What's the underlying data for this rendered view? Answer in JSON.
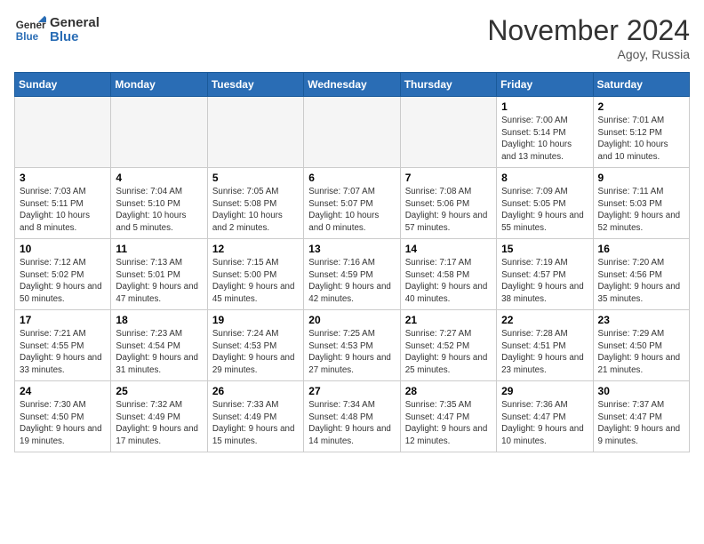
{
  "header": {
    "logo_general": "General",
    "logo_blue": "Blue",
    "month": "November 2024",
    "location": "Agoy, Russia"
  },
  "weekdays": [
    "Sunday",
    "Monday",
    "Tuesday",
    "Wednesday",
    "Thursday",
    "Friday",
    "Saturday"
  ],
  "weeks": [
    [
      {
        "day": "",
        "empty": true
      },
      {
        "day": "",
        "empty": true
      },
      {
        "day": "",
        "empty": true
      },
      {
        "day": "",
        "empty": true
      },
      {
        "day": "",
        "empty": true
      },
      {
        "day": "1",
        "sunrise": "7:00 AM",
        "sunset": "5:14 PM",
        "daylight": "10 hours and 13 minutes."
      },
      {
        "day": "2",
        "sunrise": "7:01 AM",
        "sunset": "5:12 PM",
        "daylight": "10 hours and 10 minutes."
      }
    ],
    [
      {
        "day": "3",
        "sunrise": "7:03 AM",
        "sunset": "5:11 PM",
        "daylight": "10 hours and 8 minutes."
      },
      {
        "day": "4",
        "sunrise": "7:04 AM",
        "sunset": "5:10 PM",
        "daylight": "10 hours and 5 minutes."
      },
      {
        "day": "5",
        "sunrise": "7:05 AM",
        "sunset": "5:08 PM",
        "daylight": "10 hours and 2 minutes."
      },
      {
        "day": "6",
        "sunrise": "7:07 AM",
        "sunset": "5:07 PM",
        "daylight": "10 hours and 0 minutes."
      },
      {
        "day": "7",
        "sunrise": "7:08 AM",
        "sunset": "5:06 PM",
        "daylight": "9 hours and 57 minutes."
      },
      {
        "day": "8",
        "sunrise": "7:09 AM",
        "sunset": "5:05 PM",
        "daylight": "9 hours and 55 minutes."
      },
      {
        "day": "9",
        "sunrise": "7:11 AM",
        "sunset": "5:03 PM",
        "daylight": "9 hours and 52 minutes."
      }
    ],
    [
      {
        "day": "10",
        "sunrise": "7:12 AM",
        "sunset": "5:02 PM",
        "daylight": "9 hours and 50 minutes."
      },
      {
        "day": "11",
        "sunrise": "7:13 AM",
        "sunset": "5:01 PM",
        "daylight": "9 hours and 47 minutes."
      },
      {
        "day": "12",
        "sunrise": "7:15 AM",
        "sunset": "5:00 PM",
        "daylight": "9 hours and 45 minutes."
      },
      {
        "day": "13",
        "sunrise": "7:16 AM",
        "sunset": "4:59 PM",
        "daylight": "9 hours and 42 minutes."
      },
      {
        "day": "14",
        "sunrise": "7:17 AM",
        "sunset": "4:58 PM",
        "daylight": "9 hours and 40 minutes."
      },
      {
        "day": "15",
        "sunrise": "7:19 AM",
        "sunset": "4:57 PM",
        "daylight": "9 hours and 38 minutes."
      },
      {
        "day": "16",
        "sunrise": "7:20 AM",
        "sunset": "4:56 PM",
        "daylight": "9 hours and 35 minutes."
      }
    ],
    [
      {
        "day": "17",
        "sunrise": "7:21 AM",
        "sunset": "4:55 PM",
        "daylight": "9 hours and 33 minutes."
      },
      {
        "day": "18",
        "sunrise": "7:23 AM",
        "sunset": "4:54 PM",
        "daylight": "9 hours and 31 minutes."
      },
      {
        "day": "19",
        "sunrise": "7:24 AM",
        "sunset": "4:53 PM",
        "daylight": "9 hours and 29 minutes."
      },
      {
        "day": "20",
        "sunrise": "7:25 AM",
        "sunset": "4:53 PM",
        "daylight": "9 hours and 27 minutes."
      },
      {
        "day": "21",
        "sunrise": "7:27 AM",
        "sunset": "4:52 PM",
        "daylight": "9 hours and 25 minutes."
      },
      {
        "day": "22",
        "sunrise": "7:28 AM",
        "sunset": "4:51 PM",
        "daylight": "9 hours and 23 minutes."
      },
      {
        "day": "23",
        "sunrise": "7:29 AM",
        "sunset": "4:50 PM",
        "daylight": "9 hours and 21 minutes."
      }
    ],
    [
      {
        "day": "24",
        "sunrise": "7:30 AM",
        "sunset": "4:50 PM",
        "daylight": "9 hours and 19 minutes."
      },
      {
        "day": "25",
        "sunrise": "7:32 AM",
        "sunset": "4:49 PM",
        "daylight": "9 hours and 17 minutes."
      },
      {
        "day": "26",
        "sunrise": "7:33 AM",
        "sunset": "4:49 PM",
        "daylight": "9 hours and 15 minutes."
      },
      {
        "day": "27",
        "sunrise": "7:34 AM",
        "sunset": "4:48 PM",
        "daylight": "9 hours and 14 minutes."
      },
      {
        "day": "28",
        "sunrise": "7:35 AM",
        "sunset": "4:47 PM",
        "daylight": "9 hours and 12 minutes."
      },
      {
        "day": "29",
        "sunrise": "7:36 AM",
        "sunset": "4:47 PM",
        "daylight": "9 hours and 10 minutes."
      },
      {
        "day": "30",
        "sunrise": "7:37 AM",
        "sunset": "4:47 PM",
        "daylight": "9 hours and 9 minutes."
      }
    ]
  ]
}
